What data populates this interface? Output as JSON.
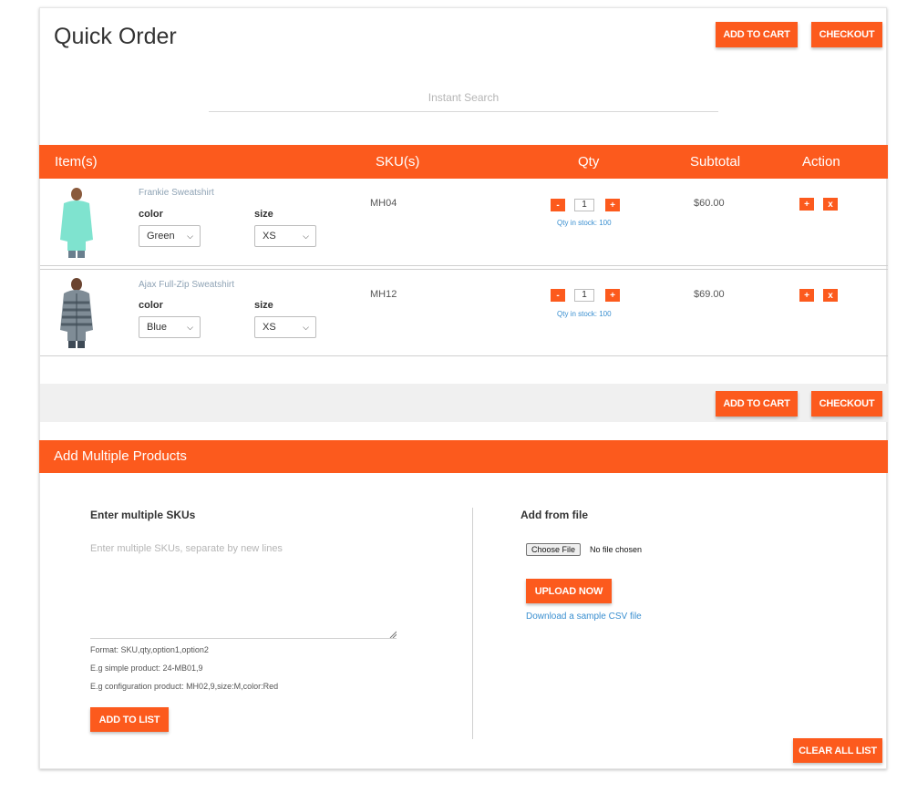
{
  "header": {
    "title": "Quick Order",
    "add_to_cart": "ADD TO CART",
    "checkout": "CHECKOUT"
  },
  "search": {
    "placeholder": "Instant Search"
  },
  "table": {
    "columns": [
      "Item(s)",
      "SKU(s)",
      "Qty",
      "Subtotal",
      "Action"
    ],
    "rows": [
      {
        "name": "Frankie Sweatshirt",
        "image": "man-in-mint-sweatshirt",
        "color_label": "color",
        "color_value": "Green",
        "size_label": "size",
        "size_value": "XS",
        "sku": "MH04",
        "qty": "1",
        "stock": "Qty in stock: 100",
        "subtotal": "$60.00"
      },
      {
        "name": "Ajax Full-Zip Sweatshirt",
        "image": "man-in-striped-hoodie",
        "color_label": "color",
        "color_value": "Blue",
        "size_label": "size",
        "size_value": "XS",
        "sku": "MH12",
        "qty": "1",
        "stock": "Qty in stock: 100",
        "subtotal": "$69.00"
      }
    ],
    "qty_minus": "-",
    "qty_plus": "+",
    "action_add": "+",
    "action_remove": "x"
  },
  "footer_actions": {
    "add_to_cart": "ADD TO CART",
    "checkout": "CHECKOUT"
  },
  "multiple": {
    "title": "Add Multiple Products",
    "skus_label": "Enter multiple SKUs",
    "skus_placeholder": "Enter multiple SKUs, separate by new lines",
    "format": "Format: SKU,qty,option1,option2",
    "example_simple": "E.g simple product: 24-MB01,9",
    "example_config": "E.g configuration product: MH02,9,size:M,color:Red",
    "add_to_list": "ADD TO LIST",
    "file_label": "Add from file",
    "choose_file": "Choose File",
    "no_file": "No file chosen",
    "upload": "UPLOAD NOW",
    "sample_link": "Download a sample CSV file",
    "clear": "CLEAR ALL LIST"
  },
  "colors": {
    "accent": "#fc5a1d",
    "link": "#3a8fd0"
  }
}
